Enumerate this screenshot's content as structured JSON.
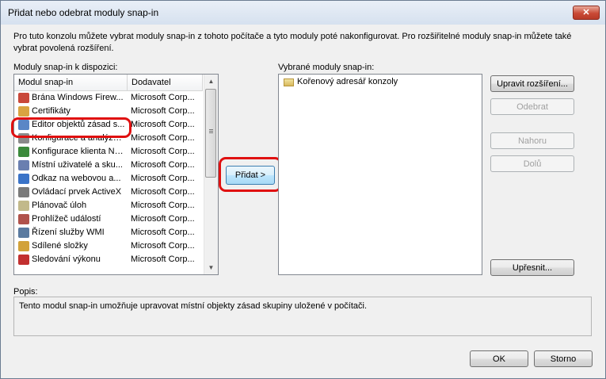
{
  "window": {
    "title": "Přidat nebo odebrat moduly snap-in",
    "close_label": "✕"
  },
  "intro": "Pro tuto konzolu můžete vybrat moduly snap-in z tohoto počítače a tyto moduly poté nakonfigurovat. Pro rozšiřitelné moduly snap-in můžete také vybrat povolená rozšíření.",
  "available": {
    "label": "Moduly snap-in k dispozici:",
    "columns": [
      "Modul snap-in",
      "Dodavatel"
    ],
    "rows": [
      {
        "name": "Brána Windows Firew...",
        "vendor": "Microsoft Corp...",
        "icon": "firewall-icon"
      },
      {
        "name": "Certifikáty",
        "vendor": "Microsoft Corp...",
        "icon": "certificate-icon"
      },
      {
        "name": "Editor objektů zásad s...",
        "vendor": "Microsoft Corp...",
        "icon": "policy-editor-icon"
      },
      {
        "name": "Konfigurace a analýza...",
        "vendor": "Microsoft Corp...",
        "icon": "security-config-icon"
      },
      {
        "name": "Konfigurace klienta NAP",
        "vendor": "Microsoft Corp...",
        "icon": "nap-client-icon"
      },
      {
        "name": "Místní uživatelé a sku...",
        "vendor": "Microsoft Corp...",
        "icon": "users-icon"
      },
      {
        "name": "Odkaz na webovou a...",
        "vendor": "Microsoft Corp...",
        "icon": "web-link-icon"
      },
      {
        "name": "Ovládací prvek ActiveX",
        "vendor": "Microsoft Corp...",
        "icon": "activex-icon"
      },
      {
        "name": "Plánovač úloh",
        "vendor": "Microsoft Corp...",
        "icon": "task-scheduler-icon"
      },
      {
        "name": "Prohlížeč událostí",
        "vendor": "Microsoft Corp...",
        "icon": "event-viewer-icon"
      },
      {
        "name": "Řízení služby WMI",
        "vendor": "Microsoft Corp...",
        "icon": "wmi-icon"
      },
      {
        "name": "Sdílené složky",
        "vendor": "Microsoft Corp...",
        "icon": "shared-folders-icon"
      },
      {
        "name": "Sledování výkonu",
        "vendor": "Microsoft Corp...",
        "icon": "performance-icon"
      }
    ]
  },
  "selected": {
    "label": "Vybrané moduly snap-in:",
    "root": "Kořenový adresář konzoly"
  },
  "buttons": {
    "add": "Přidat >",
    "edit_extensions": "Upravit rozšíření...",
    "remove": "Odebrat",
    "up": "Nahoru",
    "down": "Dolů",
    "advanced": "Upřesnit...",
    "ok": "OK",
    "cancel": "Storno"
  },
  "description": {
    "label": "Popis:",
    "text": "Tento modul snap-in umožňuje upravovat místní objekty zásad skupiny uložené v počítači."
  },
  "colors": {
    "highlight": "#e01010",
    "title_gradient": "#d6e1ef"
  }
}
